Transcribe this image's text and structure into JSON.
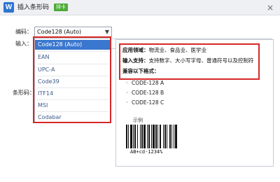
{
  "window": {
    "title": "插入条形码",
    "badge": "排卡",
    "close_glyph": "×"
  },
  "form": {
    "encoding_label": "编码：",
    "input_label": "输入：",
    "barcode_label": "条形码："
  },
  "encoding_select": {
    "value": "Code128 (Auto)",
    "arrow": "▼",
    "options": [
      "Code128 (Auto)",
      "EAN",
      "UPC-A",
      "Code39",
      "ITF14",
      "MSI",
      "Codabar"
    ],
    "selected_index": 0
  },
  "info": {
    "line1_title": "应用领域：",
    "line1_text": "物流业、食品业、医学业",
    "line2_title": "输入支持：",
    "line2_text": "支持数字、大小写字母、普通符号以及控制符",
    "line3": "兼容以下格式："
  },
  "formats": [
    "CODE-128 A",
    "CODE-128 B",
    "CODE-128 C"
  ],
  "example": {
    "label": "示例",
    "text": "AB+cd-1234%"
  },
  "colors": {
    "highlight": "#d62828",
    "selected": "#3a77cf",
    "badge": "#4dab36",
    "app_icon": "#2f74d0"
  }
}
